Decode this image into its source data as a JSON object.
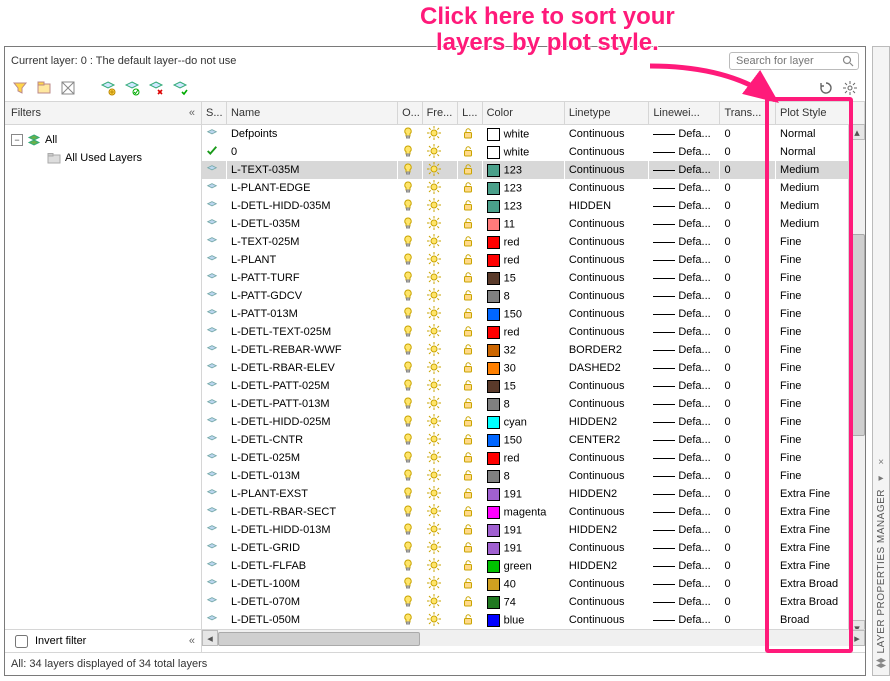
{
  "annotation": {
    "line1": "Click here to sort your",
    "line2": "layers by plot style."
  },
  "top": {
    "current_layer": "Current layer: 0 : The default layer--do not use",
    "search_placeholder": "Search for layer"
  },
  "filter": {
    "title": "Filters",
    "collapse": "«",
    "tree": [
      {
        "label": "All",
        "depth": 0,
        "exp": true,
        "icon": "layers"
      },
      {
        "label": "All Used Layers",
        "depth": 1,
        "exp": false,
        "icon": "folder"
      }
    ],
    "invert_label": "Invert filter"
  },
  "columns": [
    "S...",
    "Name",
    "O...",
    "Fre...",
    "L...",
    "Color",
    "Linetype",
    "Linewei...",
    "Trans...",
    "Plot Style"
  ],
  "rows": [
    {
      "status": "layer",
      "name": "Defpoints",
      "color_name": "white",
      "color": "#ffffff",
      "linetype": "Continuous",
      "lweight": "Defa...",
      "trans": "0",
      "pstyle": "Normal",
      "sel": false
    },
    {
      "status": "check",
      "name": "0",
      "color_name": "white",
      "color": "#ffffff",
      "linetype": "Continuous",
      "lweight": "Defa...",
      "trans": "0",
      "pstyle": "Normal",
      "sel": false
    },
    {
      "status": "layer",
      "name": "L-TEXT-035M",
      "color_name": "123",
      "color": "#4aa08a",
      "linetype": "Continuous",
      "lweight": "Defa...",
      "trans": "0",
      "pstyle": "Medium",
      "sel": true
    },
    {
      "status": "layer",
      "name": "L-PLANT-EDGE",
      "color_name": "123",
      "color": "#4aa08a",
      "linetype": "Continuous",
      "lweight": "Defa...",
      "trans": "0",
      "pstyle": "Medium",
      "sel": false
    },
    {
      "status": "layer",
      "name": "L-DETL-HIDD-035M",
      "color_name": "123",
      "color": "#4aa08a",
      "linetype": "HIDDEN",
      "lweight": "Defa...",
      "trans": "0",
      "pstyle": "Medium",
      "sel": false
    },
    {
      "status": "layer",
      "name": "L-DETL-035M",
      "color_name": "11",
      "color": "#ff7b7b",
      "linetype": "Continuous",
      "lweight": "Defa...",
      "trans": "0",
      "pstyle": "Medium",
      "sel": false
    },
    {
      "status": "layer",
      "name": "L-TEXT-025M",
      "color_name": "red",
      "color": "#ff0000",
      "linetype": "Continuous",
      "lweight": "Defa...",
      "trans": "0",
      "pstyle": "Fine",
      "sel": false
    },
    {
      "status": "layer",
      "name": "L-PLANT",
      "color_name": "red",
      "color": "#ff0000",
      "linetype": "Continuous",
      "lweight": "Defa...",
      "trans": "0",
      "pstyle": "Fine",
      "sel": false
    },
    {
      "status": "layer",
      "name": "L-PATT-TURF",
      "color_name": "15",
      "color": "#5a3a2a",
      "linetype": "Continuous",
      "lweight": "Defa...",
      "trans": "0",
      "pstyle": "Fine",
      "sel": false
    },
    {
      "status": "layer",
      "name": "L-PATT-GDCV",
      "color_name": "8",
      "color": "#808080",
      "linetype": "Continuous",
      "lweight": "Defa...",
      "trans": "0",
      "pstyle": "Fine",
      "sel": false
    },
    {
      "status": "layer",
      "name": "L-PATT-013M",
      "color_name": "150",
      "color": "#0066ff",
      "linetype": "Continuous",
      "lweight": "Defa...",
      "trans": "0",
      "pstyle": "Fine",
      "sel": false
    },
    {
      "status": "layer",
      "name": "L-DETL-TEXT-025M",
      "color_name": "red",
      "color": "#ff0000",
      "linetype": "Continuous",
      "lweight": "Defa...",
      "trans": "0",
      "pstyle": "Fine",
      "sel": false
    },
    {
      "status": "layer",
      "name": "L-DETL-REBAR-WWF",
      "color_name": "32",
      "color": "#cc6600",
      "linetype": "BORDER2",
      "lweight": "Defa...",
      "trans": "0",
      "pstyle": "Fine",
      "sel": false
    },
    {
      "status": "layer",
      "name": "L-DETL-RBAR-ELEV",
      "color_name": "30",
      "color": "#ff8000",
      "linetype": "DASHED2",
      "lweight": "Defa...",
      "trans": "0",
      "pstyle": "Fine",
      "sel": false
    },
    {
      "status": "layer",
      "name": "L-DETL-PATT-025M",
      "color_name": "15",
      "color": "#5a3a2a",
      "linetype": "Continuous",
      "lweight": "Defa...",
      "trans": "0",
      "pstyle": "Fine",
      "sel": false
    },
    {
      "status": "layer",
      "name": "L-DETL-PATT-013M",
      "color_name": "8",
      "color": "#808080",
      "linetype": "Continuous",
      "lweight": "Defa...",
      "trans": "0",
      "pstyle": "Fine",
      "sel": false
    },
    {
      "status": "layer",
      "name": "L-DETL-HIDD-025M",
      "color_name": "cyan",
      "color": "#00ffff",
      "linetype": "HIDDEN2",
      "lweight": "Defa...",
      "trans": "0",
      "pstyle": "Fine",
      "sel": false
    },
    {
      "status": "layer",
      "name": "L-DETL-CNTR",
      "color_name": "150",
      "color": "#0066ff",
      "linetype": "CENTER2",
      "lweight": "Defa...",
      "trans": "0",
      "pstyle": "Fine",
      "sel": false
    },
    {
      "status": "layer",
      "name": "L-DETL-025M",
      "color_name": "red",
      "color": "#ff0000",
      "linetype": "Continuous",
      "lweight": "Defa...",
      "trans": "0",
      "pstyle": "Fine",
      "sel": false
    },
    {
      "status": "layer",
      "name": "L-DETL-013M",
      "color_name": "8",
      "color": "#808080",
      "linetype": "Continuous",
      "lweight": "Defa...",
      "trans": "0",
      "pstyle": "Fine",
      "sel": false
    },
    {
      "status": "layer",
      "name": "L-PLANT-EXST",
      "color_name": "191",
      "color": "#a060d0",
      "linetype": "HIDDEN2",
      "lweight": "Defa...",
      "trans": "0",
      "pstyle": "Extra Fine",
      "sel": false
    },
    {
      "status": "layer",
      "name": "L-DETL-RBAR-SECT",
      "color_name": "magenta",
      "color": "#ff00ff",
      "linetype": "Continuous",
      "lweight": "Defa...",
      "trans": "0",
      "pstyle": "Extra Fine",
      "sel": false
    },
    {
      "status": "layer",
      "name": "L-DETL-HIDD-013M",
      "color_name": "191",
      "color": "#a060d0",
      "linetype": "HIDDEN2",
      "lweight": "Defa...",
      "trans": "0",
      "pstyle": "Extra Fine",
      "sel": false
    },
    {
      "status": "layer",
      "name": "L-DETL-GRID",
      "color_name": "191",
      "color": "#a060d0",
      "linetype": "Continuous",
      "lweight": "Defa...",
      "trans": "0",
      "pstyle": "Extra Fine",
      "sel": false
    },
    {
      "status": "layer",
      "name": "L-DETL-FLFAB",
      "color_name": "green",
      "color": "#00c000",
      "linetype": "HIDDEN2",
      "lweight": "Defa...",
      "trans": "0",
      "pstyle": "Extra Fine",
      "sel": false
    },
    {
      "status": "layer",
      "name": "L-DETL-100M",
      "color_name": "40",
      "color": "#d0a020",
      "linetype": "Continuous",
      "lweight": "Defa...",
      "trans": "0",
      "pstyle": "Extra Broad",
      "sel": false
    },
    {
      "status": "layer",
      "name": "L-DETL-070M",
      "color_name": "74",
      "color": "#207820",
      "linetype": "Continuous",
      "lweight": "Defa...",
      "trans": "0",
      "pstyle": "Extra Broad",
      "sel": false
    },
    {
      "status": "layer",
      "name": "L-DETL-050M",
      "color_name": "blue",
      "color": "#0000ff",
      "linetype": "Continuous",
      "lweight": "Defa...",
      "trans": "0",
      "pstyle": "Broad",
      "sel": false
    }
  ],
  "status_text": "All: 34 layers displayed of 34 total layers",
  "sidebar_title": "LAYER PROPERTIES MANAGER"
}
